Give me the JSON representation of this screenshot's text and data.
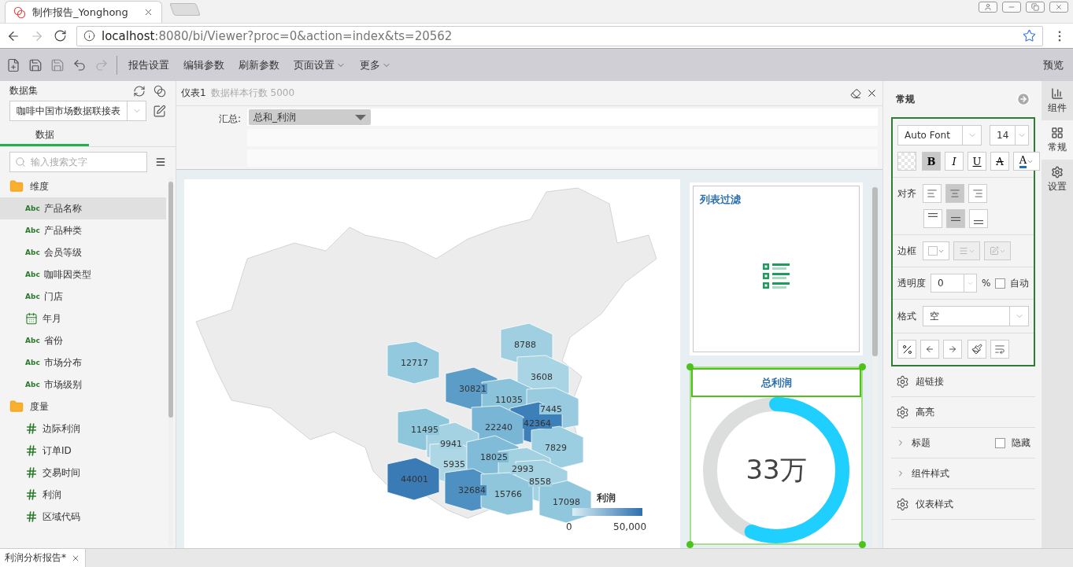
{
  "browser": {
    "tab_title": "制作报告_Yonghong",
    "url_host": "localhost",
    "url_rest": ":8080/bi/Viewer?proc=0&action=index&ts=20562"
  },
  "toolbar": {
    "menus": [
      {
        "label": "报告设置",
        "dropdown": false
      },
      {
        "label": "编辑参数",
        "dropdown": false
      },
      {
        "label": "刷新参数",
        "dropdown": false
      },
      {
        "label": "页面设置",
        "dropdown": true
      },
      {
        "label": "更多",
        "dropdown": true
      }
    ],
    "preview": "预览"
  },
  "data_panel": {
    "title": "数据集",
    "dataset": "咖啡中国市场数据联接表",
    "tabs": [
      {
        "label": "数据",
        "selected": true
      }
    ],
    "search_placeholder": "输入搜索文字",
    "tree": [
      {
        "label": "维度",
        "children": [
          {
            "label": "产品名称",
            "kind": "text",
            "badge": "Abc",
            "selected": true
          },
          {
            "label": "产品种类",
            "kind": "text",
            "badge": "Abc",
            "selected": false
          },
          {
            "label": "会员等级",
            "kind": "text",
            "badge": "Abc",
            "selected": false
          },
          {
            "label": "咖啡因类型",
            "kind": "text",
            "badge": "Abc",
            "selected": false
          },
          {
            "label": "门店",
            "kind": "text",
            "badge": "Abc",
            "selected": false
          },
          {
            "label": "年月",
            "kind": "date",
            "selected": false
          },
          {
            "label": "省份",
            "kind": "text",
            "badge": "Abc",
            "selected": false
          },
          {
            "label": "市场分布",
            "kind": "text",
            "badge": "Abc",
            "selected": false
          },
          {
            "label": "市场级别",
            "kind": "text",
            "badge": "Abc",
            "selected": false
          }
        ]
      },
      {
        "label": "度量",
        "children": [
          {
            "label": "边际利润",
            "kind": "number",
            "selected": false
          },
          {
            "label": "订单ID",
            "kind": "number",
            "selected": false
          },
          {
            "label": "交易时间",
            "kind": "number",
            "selected": false
          },
          {
            "label": "利润",
            "kind": "number",
            "selected": false
          },
          {
            "label": "区域代码",
            "kind": "number",
            "selected": false
          }
        ]
      }
    ]
  },
  "editor": {
    "component": "仪表1",
    "sample": "数据样本行数 5000",
    "summary_label": "汇总:",
    "summary_value": "总和_利润"
  },
  "map": {
    "regions": [
      {
        "value": "8788",
        "color": "#9fcfe1"
      },
      {
        "value": "12717",
        "color": "#92c9de"
      },
      {
        "value": "3608",
        "color": "#a8d4e4"
      },
      {
        "value": "30821",
        "color": "#5c9dc8"
      },
      {
        "value": "11035",
        "color": "#8bc3db"
      },
      {
        "value": "7445",
        "color": "#98cbe0"
      },
      {
        "value": "42364",
        "color": "#3d7fb8"
      },
      {
        "value": "11495",
        "color": "#8ec6dc"
      },
      {
        "value": "22240",
        "color": "#79b5d5"
      },
      {
        "value": "9941",
        "color": "#a4d2e3"
      },
      {
        "value": "7829",
        "color": "#9ccee1"
      },
      {
        "value": "5935",
        "color": "#aed7e6"
      },
      {
        "value": "18025",
        "color": "#80bbd8"
      },
      {
        "value": "2993",
        "color": "#a2d1e2"
      },
      {
        "value": "8558",
        "color": "#a5d2e3"
      },
      {
        "value": "44001",
        "color": "#3a7bb5"
      },
      {
        "value": "32684",
        "color": "#4f90c2"
      },
      {
        "value": "15766",
        "color": "#8fc6dc"
      },
      {
        "value": "17098",
        "color": "#90c7dd"
      }
    ],
    "legend": {
      "title": "利润",
      "min": "0",
      "max": "50,000"
    }
  },
  "filter": {
    "title": "列表过滤"
  },
  "gauge": {
    "title": "总利润",
    "value": "33万",
    "level": 0.56
  },
  "format_panel": {
    "title": "常规",
    "font": "Auto Font",
    "size": "14",
    "styles": [
      {
        "kind": "bold",
        "label": "B",
        "selected": true
      },
      {
        "kind": "italic",
        "label": "I",
        "selected": false
      },
      {
        "kind": "underline",
        "label": "U",
        "selected": false
      },
      {
        "kind": "strike",
        "label": "A",
        "selected": false
      },
      {
        "kind": "color",
        "label": "A",
        "selected": false
      }
    ],
    "align_label": "对齐",
    "h_align": [
      {
        "kind": "left",
        "selected": false
      },
      {
        "kind": "center",
        "selected": true
      },
      {
        "kind": "right",
        "selected": false
      }
    ],
    "v_align": [
      {
        "kind": "top",
        "selected": false
      },
      {
        "kind": "middle",
        "selected": true
      },
      {
        "kind": "bottom",
        "selected": false
      }
    ],
    "border_label": "边框",
    "opacity_label": "透明度",
    "opacity": "0",
    "opacity_unit": "%",
    "auto": {
      "label": "自动",
      "checked": false
    },
    "format_label": "格式",
    "format": "空",
    "sections": [
      {
        "kind": "gear",
        "label": "超链接"
      },
      {
        "kind": "gear",
        "label": "高亮"
      },
      {
        "kind": "expand",
        "label": "标题",
        "expanded": false,
        "hide": {
          "label": "隐藏",
          "checked": false
        }
      },
      {
        "kind": "expand",
        "label": "组件样式",
        "expanded": false
      },
      {
        "kind": "gear",
        "label": "仪表样式"
      }
    ]
  },
  "side_tabs": [
    {
      "kind": "components",
      "label": "组件",
      "selected": false
    },
    {
      "kind": "general",
      "label": "常规",
      "selected": true
    },
    {
      "kind": "settings",
      "label": "设置",
      "selected": false
    }
  ],
  "bottom_tabs": [
    {
      "label": "利润分析报告*",
      "selected": true
    }
  ]
}
